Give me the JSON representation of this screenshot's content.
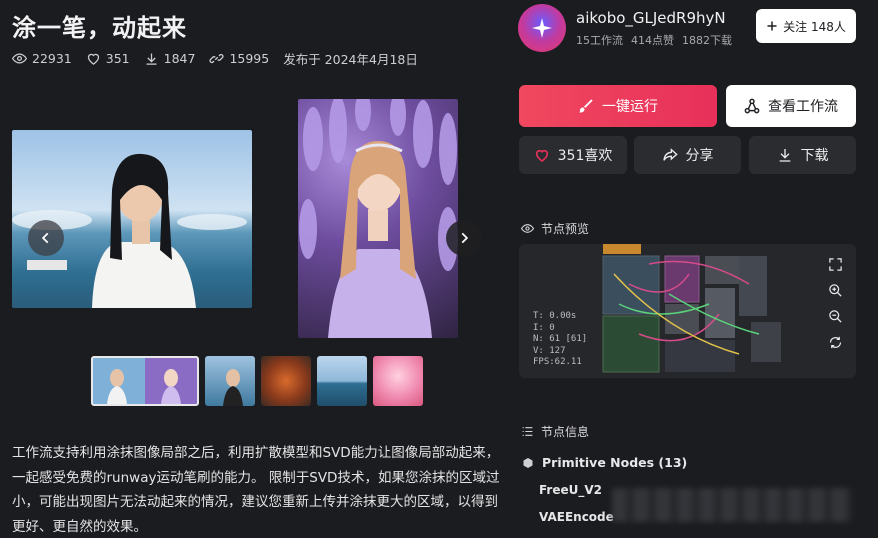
{
  "post": {
    "title": "涂一笔，动起来",
    "views": "22931",
    "likes": "351",
    "downloads": "1847",
    "runs": "15995",
    "published": "发布于 2024年4月18日",
    "description": "工作流支持利用涂抹图像局部之后，利用扩散模型和SVD能力让图像局部动起来，一起感受免费的runway运动笔刷的能力。 限制于SVD技术，如果您涂抹的区域过小，可能出现图片无法动起来的情况，建议您重新上传并涂抹更大的区域，以得到更好、更自然的效果。"
  },
  "author": {
    "name": "aikobo_GLJedR9hyN",
    "workflows": "15工作流",
    "likes_received": "414点赞",
    "downloads": "1882下载",
    "follow_label": "关注 148人"
  },
  "actions": {
    "run_label": "一键运行",
    "view_label": "查看工作流",
    "like_label": "351喜欢",
    "share_label": "分享",
    "download_label": "下载"
  },
  "preview": {
    "heading": "节点预览",
    "stats": [
      "T: 0.00s",
      "I: 0",
      "N: 61 [61]",
      "V: 127",
      "FPS:62.11"
    ]
  },
  "node_info": {
    "heading": "节点信息",
    "group": "Primitive Nodes (13)",
    "items": [
      "FreeU_V2",
      "VAEEncode"
    ]
  },
  "colors": {
    "accent": "#e8305a",
    "background": "#1b1c1f",
    "card": "#2b2c30"
  }
}
